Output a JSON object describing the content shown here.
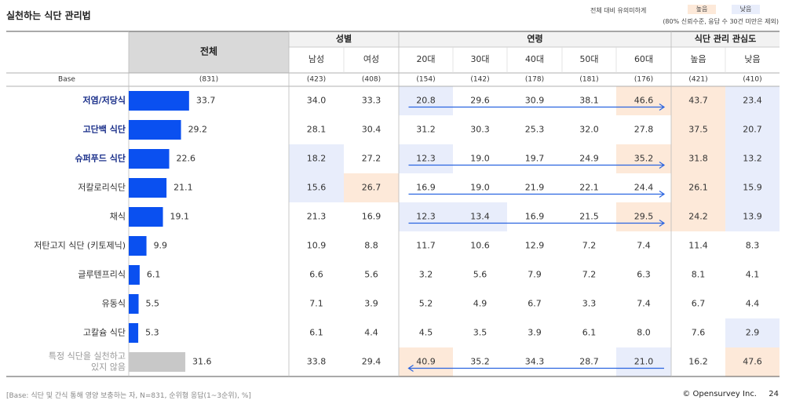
{
  "title": "실천하는 식단 관리법",
  "legend": {
    "label": "전체 대비 유의미하게",
    "high": "높음",
    "low": "낮음",
    "high_color": "#fde9d9",
    "low_color": "#e8edfb",
    "note": "(80% 신뢰수준, 응답 수 30건 미만은 제외)"
  },
  "footnote": "[Base: 식단 및 간식 통해 영양 보충하는 자, N=831, 순위형 응답(1~3순위), %]",
  "copyright": "© Opensurvey Inc.",
  "page_number": "24",
  "chart_data": {
    "type": "table",
    "base_label": "Base",
    "total_header": "전체",
    "groups": [
      {
        "name": "성별",
        "columns": [
          "남성",
          "여성"
        ]
      },
      {
        "name": "연령",
        "columns": [
          "20대",
          "30대",
          "40대",
          "50대",
          "60대"
        ]
      },
      {
        "name": "식단 관리 관심도",
        "columns": [
          "높음",
          "낮음"
        ]
      }
    ],
    "base": {
      "total": "(831)",
      "columns": [
        "(423)",
        "(408)",
        "(154)",
        "(142)",
        "(178)",
        "(181)",
        "(176)",
        "(421)",
        "(410)"
      ]
    },
    "bar_color": "#0a50f0",
    "bar_color_muted": "#c8c8c8",
    "arrow_color": "#2a64e0",
    "rows": [
      {
        "label": "저염/저당식",
        "emphasis": true,
        "total": 33.7,
        "values": [
          34.0,
          33.3,
          20.8,
          29.6,
          30.9,
          38.1,
          46.6,
          43.7,
          23.4
        ],
        "sig": [
          "",
          "",
          "low",
          "",
          "",
          "",
          "high",
          "high",
          "low"
        ],
        "trend": "up"
      },
      {
        "label": "고단백 식단",
        "emphasis": true,
        "total": 29.2,
        "values": [
          28.1,
          30.4,
          31.2,
          30.3,
          25.3,
          32.0,
          27.8,
          37.5,
          20.7
        ],
        "sig": [
          "",
          "",
          "",
          "",
          "",
          "",
          "",
          "high",
          "low"
        ],
        "trend": ""
      },
      {
        "label": "슈퍼푸드 식단",
        "emphasis": true,
        "total": 22.6,
        "values": [
          18.2,
          27.2,
          12.3,
          19.0,
          19.7,
          24.9,
          35.2,
          31.8,
          13.2
        ],
        "sig": [
          "low",
          "",
          "low",
          "",
          "",
          "",
          "high",
          "high",
          "low"
        ],
        "trend": "up"
      },
      {
        "label": "저칼로리식단",
        "emphasis": false,
        "total": 21.1,
        "values": [
          15.6,
          26.7,
          16.9,
          19.0,
          21.9,
          22.1,
          24.4,
          26.1,
          15.9
        ],
        "sig": [
          "low",
          "high",
          "",
          "",
          "",
          "",
          "",
          "high",
          "low"
        ],
        "trend": "up"
      },
      {
        "label": "채식",
        "emphasis": false,
        "total": 19.1,
        "values": [
          21.3,
          16.9,
          12.3,
          13.4,
          16.9,
          21.5,
          29.5,
          24.2,
          13.9
        ],
        "sig": [
          "",
          "",
          "low",
          "low",
          "",
          "",
          "high",
          "high",
          "low"
        ],
        "trend": "up"
      },
      {
        "label": "저탄고지 식단 (키토제닉)",
        "emphasis": false,
        "total": 9.9,
        "values": [
          10.9,
          8.8,
          11.7,
          10.6,
          12.9,
          7.2,
          7.4,
          11.4,
          8.3
        ],
        "sig": [
          "",
          "",
          "",
          "",
          "",
          "",
          "",
          "",
          ""
        ],
        "trend": ""
      },
      {
        "label": "글루텐프리식",
        "emphasis": false,
        "total": 6.1,
        "values": [
          6.6,
          5.6,
          3.2,
          5.6,
          7.9,
          7.2,
          6.3,
          8.1,
          4.1
        ],
        "sig": [
          "",
          "",
          "",
          "",
          "",
          "",
          "",
          "",
          ""
        ],
        "trend": ""
      },
      {
        "label": "유동식",
        "emphasis": false,
        "total": 5.5,
        "values": [
          7.1,
          3.9,
          5.2,
          4.9,
          6.7,
          3.3,
          7.4,
          6.7,
          4.4
        ],
        "sig": [
          "",
          "",
          "",
          "",
          "",
          "",
          "",
          "",
          ""
        ],
        "trend": ""
      },
      {
        "label": "고칼슘 식단",
        "emphasis": false,
        "total": 5.3,
        "values": [
          6.1,
          4.4,
          4.5,
          3.5,
          3.9,
          6.1,
          8.0,
          7.6,
          2.9
        ],
        "sig": [
          "",
          "",
          "",
          "",
          "",
          "",
          "",
          "",
          "low"
        ],
        "trend": ""
      },
      {
        "label": "특정 식단을 실천하고 있지 않음",
        "label_lines": [
          "특정 식단을 실천하고",
          "있지 않음"
        ],
        "emphasis": false,
        "muted": true,
        "total": 31.6,
        "values": [
          33.8,
          29.4,
          40.9,
          35.2,
          34.3,
          28.7,
          21.0,
          16.2,
          47.6
        ],
        "sig": [
          "",
          "",
          "high",
          "",
          "",
          "",
          "low",
          "",
          "high"
        ],
        "trend": "down"
      }
    ]
  }
}
